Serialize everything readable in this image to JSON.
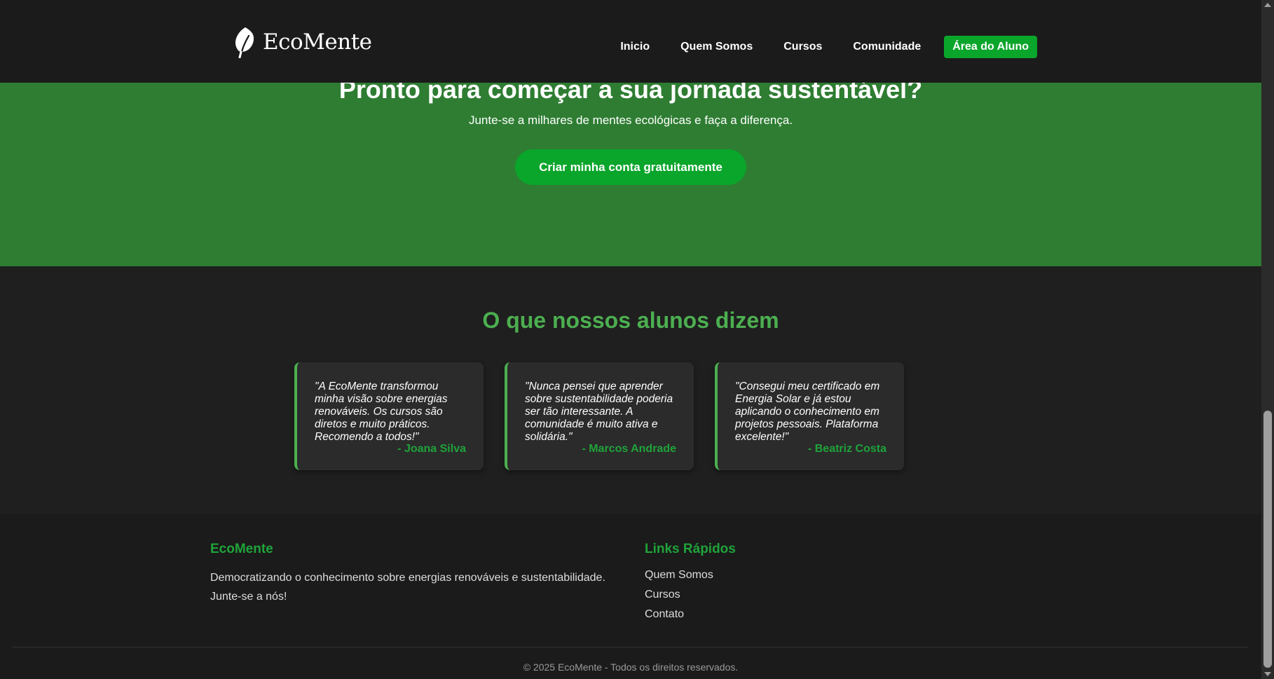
{
  "header": {
    "logo_text": "EcoMente",
    "nav": [
      {
        "label": "Inicio"
      },
      {
        "label": "Quem Somos"
      },
      {
        "label": "Cursos"
      },
      {
        "label": "Comunidade"
      }
    ],
    "cta_label": "Área do Aluno"
  },
  "hero": {
    "title": "Pronto para começar a sua jornada sustentável?",
    "subtitle": "Junte-se a milhares de mentes ecológicas e faça a diferença.",
    "button_label": "Criar minha conta gratuitamente"
  },
  "testimonials": {
    "title": "O que nossos alunos dizem",
    "items": [
      {
        "quote": "\"A EcoMente transformou minha visão sobre energias renováveis. Os cursos são diretos e muito práticos. Recomendo a todos!\"",
        "author": "- Joana Silva"
      },
      {
        "quote": "\"Nunca pensei que aprender sobre sustentabilidade poderia ser tão interessante. A comunidade é muito ativa e solidária.\"",
        "author": "- Marcos Andrade"
      },
      {
        "quote": "\"Consegui meu certificado em Energia Solar e já estou aplicando o conhecimento em projetos pessoais. Plataforma excelente!\"",
        "author": "- Beatriz Costa"
      }
    ]
  },
  "footer": {
    "brand_heading": "EcoMente",
    "brand_text": "Democratizando o conhecimento sobre energias renováveis e sustentabilidade. Junte-se a nós!",
    "links_heading": "Links Rápidos",
    "links": [
      {
        "label": "Quem Somos"
      },
      {
        "label": "Cursos"
      },
      {
        "label": "Contato"
      }
    ],
    "copyright": "© 2025 EcoMente - Todos os direitos reservados."
  },
  "colors": {
    "accent_green": "#0aa52b",
    "hero_green": "#2e7d32",
    "heading_green": "#4caf50",
    "background": "#1f1f1f"
  },
  "icons": {
    "logo": "leaf-icon"
  }
}
